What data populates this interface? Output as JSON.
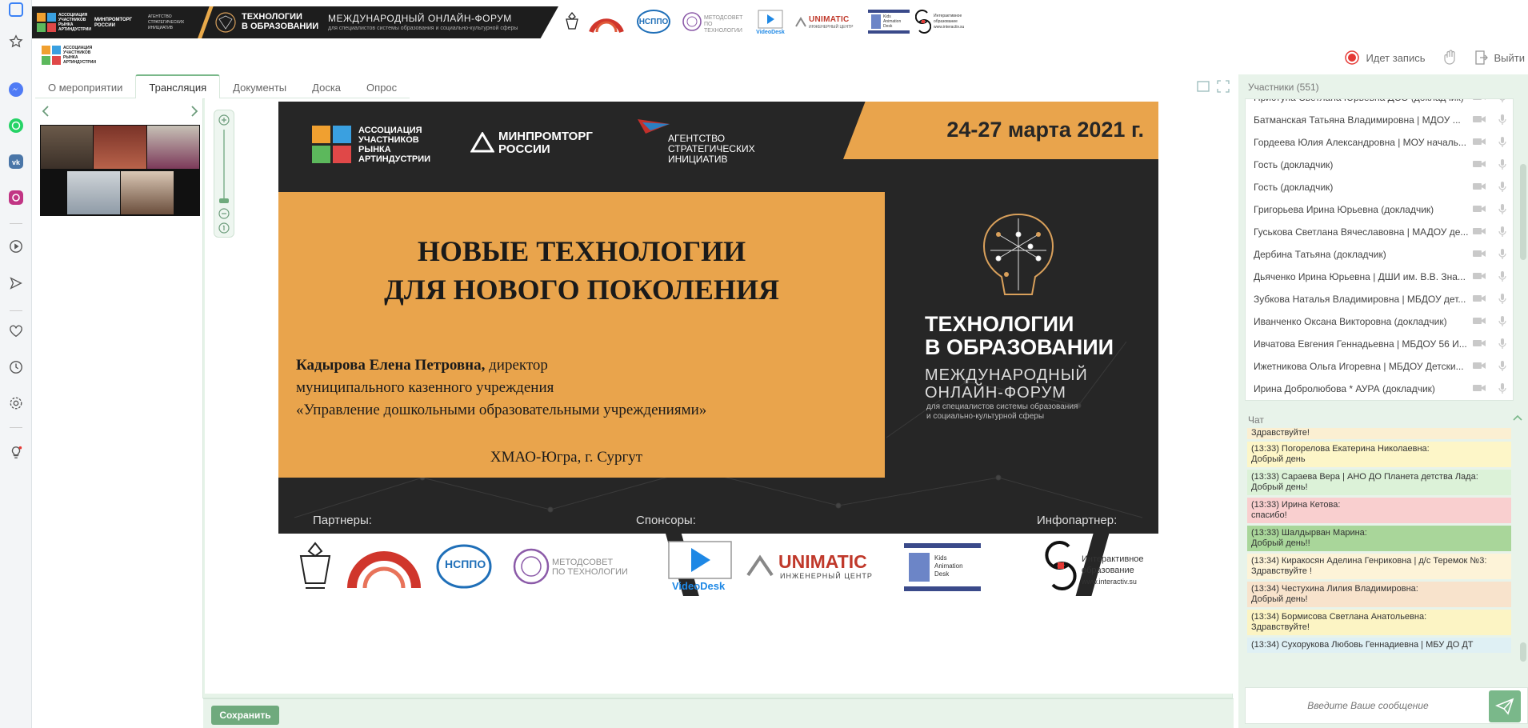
{
  "banner": {
    "assoc_label": "АССОЦИАЦИЯ УЧАСТНИКОВ РЫНКА АРТИНДУСТРИИ",
    "minprom_label": "МИНПРОМТОРГ РОССИИ",
    "agency_label": "АГЕНТСТВО СТРАТЕГИЧЕСКИХ ИНИЦИАТИВ",
    "title_line1": "ТЕХНОЛОГИИ",
    "title_line2": "В ОБРАЗОВАНИИ",
    "forum_title": "МЕЖДУНАРОДНЫЙ ОНЛАЙН-ФОРУМ",
    "forum_sub": "для специалистов системы образования и социально-культурной сферы"
  },
  "partner_logos": {
    "nspo": "НСППО",
    "metodsovet_1": "МЕТОДСОВЕТ",
    "metodsovet_2": "ПО ТЕХНОЛОГИИ",
    "videodesk": "VideoDesk",
    "unimatic": "UNIMATIC",
    "unimatic_sub": "ИНЖЕНЕРНЫЙ ЦЕНТР",
    "kids_1": "Kids",
    "kids_2": "Animation",
    "kids_3": "Desk",
    "interactive_1": "Интерактивное",
    "interactive_2": "образование",
    "interactive_3": "www.interactiv.su"
  },
  "org_logo_label": "АССОЦИАЦИЯ УЧАСТНИКОВ РЫНКА АРТИНДУСТРИИ",
  "top_controls": {
    "recording": "Идет запись",
    "exit": "Выйти"
  },
  "tabs": [
    "О мероприятии",
    "Трансляция",
    "Документы",
    "Доска",
    "Опрос"
  ],
  "active_tab": 1,
  "slide": {
    "dates": "24-27 марта 2021 г.",
    "headline1": "НОВЫЕ ТЕХНОЛОГИИ",
    "headline2": "ДЛЯ НОВОГО ПОКОЛЕНИЯ",
    "speaker_name": "Кадырова Елена Петровна,",
    "speaker_role": " директор",
    "org_line1": "муниципального казенного учреждения",
    "org_line2": "«Управление дошкольными образовательными учреждениями»",
    "location": "ХМАО-Югра, г. Сургут",
    "title_line1": "ТЕХНОЛОГИИ",
    "title_line2": "В ОБРАЗОВАНИИ",
    "forum_line1": "МЕЖДУНАРОДНЫЙ",
    "forum_line2": "ОНЛАЙН-ФОРУМ",
    "forum_sub1": "для специалистов системы образования",
    "forum_sub2": "и социально-культурной сферы",
    "partners_label": "Партнеры:",
    "sponsors_label": "Спонсоры:",
    "infopartner_label": "Инфопартнер:"
  },
  "save_button": "Сохранить",
  "participants": {
    "title": "Участники (551)",
    "items": [
      "Приступа Светлана Юрьевна ДСО (докладчик)",
      "Батманская Татьяна Владимировна | МДОУ ...",
      "Гордеева Юлия Александровна | МОУ началь...",
      "Гость (докладчик)",
      "Гость (докладчик)",
      "Григорьева Ирина Юрьевна (докладчик)",
      "Гуськова Светлана Вячеславовна | МАДОУ де...",
      "Дербина Татьяна (докладчик)",
      "Дьяченко Ирина Юрьевна | ДШИ им. В.В. Зна...",
      "Зубкова Наталья Владимировна | МБДОУ дет...",
      "Иванченко Оксана Викторовна (докладчик)",
      "Ивчатова Евгения Геннадьевна | МБДОУ 56 И...",
      "Ижетникова Ольга Игоревна | МБДОУ Детски...",
      "Ирина Добролюбова * АУРА (докладчик)"
    ]
  },
  "chat": {
    "title": "Чат",
    "partial_text": "Здравствуйте!",
    "messages": [
      {
        "head": "(13:33) Погорелова Екатерина Николаевна:",
        "text": "Добрый день",
        "color": "#fdf6c8"
      },
      {
        "head": "(13:33) Сараева Вера | АНО ДО Планета детства Лада:",
        "text": "Добрый день!",
        "color": "#dcf2d8"
      },
      {
        "head": "(13:33) Ирина Кетова:",
        "text": "спасибо!",
        "color": "#f9cfcf"
      },
      {
        "head": "(13:33) Шалдырван Марина:",
        "text": "Добрый день!!",
        "color": "#a9d69a"
      },
      {
        "head": "(13:34) Киракосян Аделина Генриковна | д/с Теремок №3:",
        "text": "Здравствуйте !",
        "color": "#fdf3d8"
      },
      {
        "head": "(13:34) Честухина Лилия Владимировна:",
        "text": "Добрый день!",
        "color": "#f8e3cc"
      },
      {
        "head": "(13:34) Бормисова Светлана Анатольевна:",
        "text": "Здравствуйте!",
        "color": "#fcf4c4"
      },
      {
        "head": "(13:34) Сухорукова Любовь Геннадиевна | МБУ ДО ДТ",
        "text": "",
        "color": "#dff0f4"
      }
    ],
    "input_placeholder": "Введите Ваше сообщение"
  },
  "colors": {
    "accent": "#6faa7d",
    "slide_orange": "#e9a44c",
    "slide_dark": "#262626",
    "panel_bg": "#e8f3ea"
  }
}
